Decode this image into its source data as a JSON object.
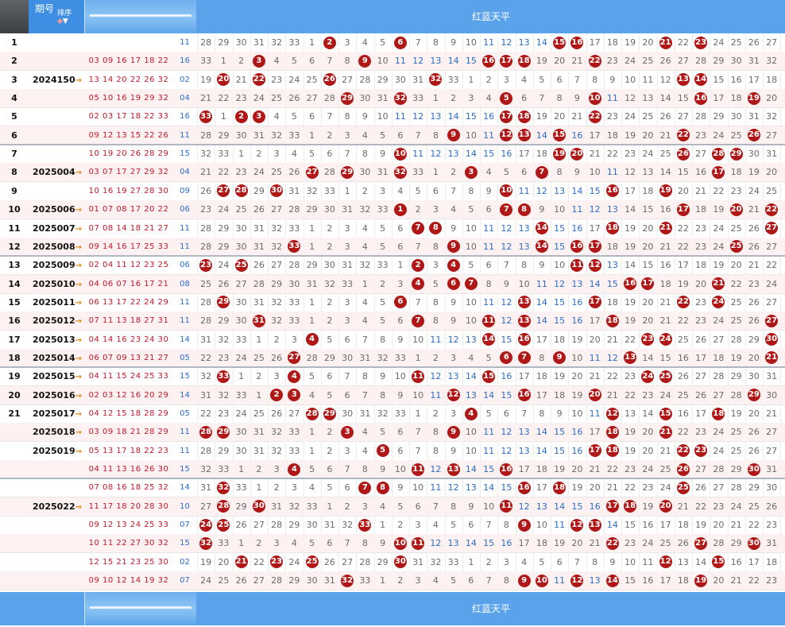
{
  "header": {
    "col_period": "期号",
    "col_sort": "排序",
    "title": "红蓝天平",
    "footer_title": "红蓝天平"
  },
  "rows": [
    {
      "idx": "1",
      "period": "",
      "nums": "",
      "blue": "11",
      "start": 28,
      "balls": [
        2,
        6,
        15,
        16,
        21,
        23
      ]
    },
    {
      "idx": "2",
      "period": "",
      "nums": "03 09 16 17 18 22",
      "blue": "16",
      "start": 33,
      "balls": [
        3,
        9,
        16,
        17,
        18,
        22
      ]
    },
    {
      "idx": "3",
      "period": "2024150",
      "nums": "13 14 20 22 26 32",
      "blue": "02",
      "start": 19,
      "balls": [
        20,
        22,
        26,
        32,
        13,
        14
      ]
    },
    {
      "idx": "4",
      "period": "",
      "nums": "05 10 16 19 29 32",
      "blue": "04",
      "start": 21,
      "balls": [
        29,
        32,
        5,
        10,
        16,
        19
      ]
    },
    {
      "idx": "5",
      "period": "",
      "nums": "02 03 17 18 22 33",
      "blue": "16",
      "start": 33,
      "balls": [
        33,
        2,
        3,
        17,
        18,
        22
      ]
    },
    {
      "idx": "6",
      "period": "",
      "nums": "09 12 13 15 22 26",
      "blue": "11",
      "start": 28,
      "balls": [
        9,
        12,
        13,
        15,
        22,
        26
      ]
    },
    {
      "idx": "7",
      "period": "",
      "nums": "10 19 20 26 28 29",
      "blue": "15",
      "start": 32,
      "balls": [
        10,
        19,
        20,
        26,
        28,
        29
      ]
    },
    {
      "idx": "8",
      "period": "2025004",
      "nums": "03 07 17 27 29 32",
      "blue": "04",
      "start": 21,
      "balls": [
        27,
        29,
        32,
        3,
        7,
        17
      ]
    },
    {
      "idx": "9",
      "period": "",
      "nums": "10 16 19 27 28 30",
      "blue": "09",
      "start": 26,
      "balls": [
        27,
        28,
        30,
        10,
        16,
        19
      ]
    },
    {
      "idx": "10",
      "period": "2025006",
      "nums": "01 07 08 17 20 22",
      "blue": "06",
      "start": 23,
      "balls": [
        1,
        7,
        8,
        17,
        20,
        22
      ]
    },
    {
      "idx": "11",
      "period": "2025007",
      "nums": "07 08 14 18 21 27",
      "blue": "11",
      "start": 28,
      "balls": [
        7,
        8,
        14,
        18,
        21,
        27
      ]
    },
    {
      "idx": "12",
      "period": "2025008",
      "nums": "09 14 16 17 25 33",
      "blue": "11",
      "start": 28,
      "balls": [
        33,
        9,
        14,
        16,
        17,
        25
      ]
    },
    {
      "idx": "13",
      "period": "2025009",
      "nums": "02 04 11 12 23 25",
      "blue": "06",
      "start": 23,
      "balls": [
        23,
        25,
        2,
        4,
        11,
        12
      ]
    },
    {
      "idx": "14",
      "period": "2025010",
      "nums": "04 06 07 16 17 21",
      "blue": "08",
      "start": 25,
      "balls": [
        4,
        6,
        7,
        16,
        17,
        21
      ]
    },
    {
      "idx": "15",
      "period": "2025011",
      "nums": "06 13 17 22 24 29",
      "blue": "11",
      "start": 28,
      "balls": [
        29,
        6,
        13,
        17,
        22,
        24
      ]
    },
    {
      "idx": "16",
      "period": "2025012",
      "nums": "07 11 13 18 27 31",
      "blue": "11",
      "start": 28,
      "balls": [
        31,
        7,
        11,
        13,
        18,
        27
      ]
    },
    {
      "idx": "17",
      "period": "2025013",
      "nums": "04 14 16 23 24 30",
      "blue": "14",
      "start": 31,
      "balls": [
        4,
        14,
        16,
        23,
        24,
        30
      ]
    },
    {
      "idx": "18",
      "period": "2025014",
      "nums": "06 07 09 13 21 27",
      "blue": "05",
      "start": 22,
      "balls": [
        27,
        6,
        7,
        9,
        13,
        21
      ]
    },
    {
      "idx": "19",
      "period": "2025015",
      "nums": "04 11 15 24 25 33",
      "blue": "15",
      "start": 32,
      "balls": [
        33,
        4,
        11,
        15,
        24,
        25
      ]
    },
    {
      "idx": "20",
      "period": "2025016",
      "nums": "02 03 12 16 20 29",
      "blue": "14",
      "start": 31,
      "balls": [
        2,
        3,
        12,
        16,
        20,
        29
      ]
    },
    {
      "idx": "21",
      "period": "2025017",
      "nums": "04 12 15 18 28 29",
      "blue": "05",
      "start": 22,
      "balls": [
        28,
        29,
        4,
        12,
        15,
        18
      ]
    },
    {
      "idx": "",
      "period": "2025018",
      "nums": "03 09 18 21 28 29",
      "blue": "11",
      "start": 28,
      "balls": [
        28,
        29,
        3,
        9,
        18,
        21
      ]
    },
    {
      "idx": "",
      "period": "2025019",
      "nums": "05 13 17 18 22 23",
      "blue": "11",
      "start": 28,
      "balls": [
        5,
        17,
        18,
        22,
        23
      ]
    },
    {
      "idx": "",
      "period": "",
      "nums": "04 11 13 16 26 30",
      "blue": "15",
      "start": 32,
      "balls": [
        4,
        11,
        13,
        16,
        26,
        30
      ]
    },
    {
      "idx": "",
      "period": "",
      "nums": "07 08 16 18 25 32",
      "blue": "14",
      "start": 31,
      "balls": [
        32,
        7,
        8,
        16,
        18,
        25
      ]
    },
    {
      "idx": "",
      "period": "2025022",
      "nums": "11 17 18 20 28 30",
      "blue": "10",
      "start": 27,
      "balls": [
        28,
        30,
        11,
        17,
        18,
        20
      ]
    },
    {
      "idx": "",
      "period": "",
      "nums": "09 12 13 24 25 33",
      "blue": "07",
      "start": 24,
      "balls": [
        24,
        25,
        33,
        9,
        12,
        13
      ]
    },
    {
      "idx": "",
      "period": "",
      "nums": "10 11 22 27 30 32",
      "blue": "15",
      "start": 32,
      "balls": [
        32,
        10,
        11,
        22,
        27,
        30
      ]
    },
    {
      "idx": "",
      "period": "",
      "nums": "12 15 21 23 25 30",
      "blue": "02",
      "start": 19,
      "balls": [
        21,
        23,
        25,
        30,
        12,
        15
      ]
    },
    {
      "idx": "",
      "period": "",
      "nums": "09 10 12 14 19 32",
      "blue": "07",
      "start": 24,
      "balls": [
        32,
        9,
        10,
        12,
        14,
        19
      ]
    }
  ],
  "colors": {
    "red": "#b01818",
    "blue_text": "#2a6dc9",
    "header": "#5aa3ea"
  }
}
